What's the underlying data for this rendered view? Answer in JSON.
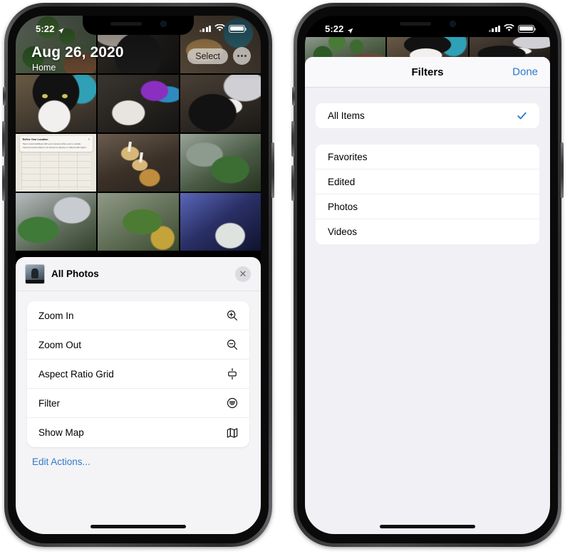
{
  "left_phone": {
    "status_bar": {
      "time": "5:22",
      "location_icon": "location-arrow-icon",
      "cellular_icon": "cellular-bars-icon",
      "wifi_icon": "wifi-icon",
      "battery_icon": "battery-icon"
    },
    "photos_header": {
      "date": "Aug 26, 2020",
      "location": "Home",
      "select_label": "Select",
      "more_icon": "ellipsis-icon"
    },
    "grid_photos": [
      {
        "name": "photo-plants-shelf",
        "alt": "Plants on a shelf"
      },
      {
        "name": "photo-cat-paw",
        "alt": "Cat paw close up"
      },
      {
        "name": "photo-kitchen",
        "alt": "Kitchen counter"
      },
      {
        "name": "photo-tuxedo-cat",
        "alt": "Tuxedo cat face"
      },
      {
        "name": "photo-desk-setup",
        "alt": "Desk with monitor"
      },
      {
        "name": "photo-cat-laptop",
        "alt": "Cat near laptop"
      },
      {
        "name": "photo-screenshot-map",
        "alt": "Refine Your Location screenshot"
      },
      {
        "name": "photo-seed-trays",
        "alt": "Seed starter trays"
      },
      {
        "name": "photo-ferns",
        "alt": "Ferns outside"
      },
      {
        "name": "photo-window-plants",
        "alt": "Plants at window"
      },
      {
        "name": "photo-garden-plant",
        "alt": "Garden plant"
      },
      {
        "name": "photo-blue-bin",
        "alt": "Blue storage bin"
      }
    ],
    "screenshot_thumb": {
      "title": "Refine Your Location",
      "body": "Tap to scan buildings with your camera when you're outside. Camera sensor data is not stored on-device or shared with Apple."
    },
    "context_menu": {
      "album_title": "All Photos",
      "album_thumb_icon": "album-thumbnail-icon",
      "close_icon": "close-icon",
      "items": [
        {
          "label": "Zoom In",
          "icon": "zoom-in-icon"
        },
        {
          "label": "Zoom Out",
          "icon": "zoom-out-icon"
        },
        {
          "label": "Aspect Ratio Grid",
          "icon": "aspect-ratio-grid-icon"
        },
        {
          "label": "Filter",
          "icon": "filter-icon"
        },
        {
          "label": "Show Map",
          "icon": "map-icon"
        }
      ],
      "edit_actions_label": "Edit Actions..."
    }
  },
  "right_phone": {
    "status_bar": {
      "time": "5:22",
      "location_icon": "location-arrow-icon",
      "cellular_icon": "cellular-bars-icon",
      "wifi_icon": "wifi-icon",
      "battery_icon": "battery-icon"
    },
    "filters_sheet": {
      "title": "Filters",
      "done_label": "Done",
      "selected_group": [
        {
          "label": "All Items",
          "selected": true,
          "check_icon": "checkmark-icon"
        }
      ],
      "filter_group": [
        {
          "label": "Favorites",
          "selected": false
        },
        {
          "label": "Edited",
          "selected": false
        },
        {
          "label": "Photos",
          "selected": false
        },
        {
          "label": "Videos",
          "selected": false
        }
      ]
    }
  },
  "colors": {
    "accent_blue": "#2a78c8",
    "link_blue": "#3478c6",
    "sheet_bg": "#f1f1f5",
    "menu_bg": "#f4f4f6",
    "card_white": "#ffffff",
    "frame_dark": "#2b2b2d"
  }
}
